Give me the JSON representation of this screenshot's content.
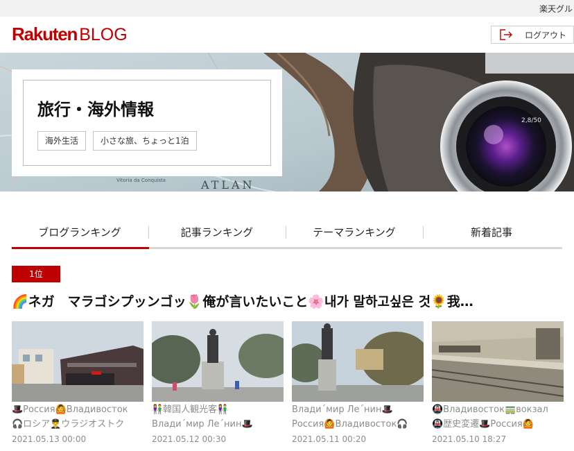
{
  "topbar": {
    "link": "楽天グル"
  },
  "header": {
    "logo_main": "Rakuten",
    "logo_sub": "BLOG",
    "logout_label": "ログアウト"
  },
  "hero": {
    "blog_title": "旅行・海外情報",
    "categories": [
      "海外生活",
      "小さな旅、ちょっと1泊"
    ],
    "map_labels": [
      "Vitoria da Conquista",
      "ATLAN"
    ],
    "lens_text": "2,8/50"
  },
  "tabs": [
    {
      "label": "ブログランキング",
      "active": true
    },
    {
      "label": "記事ランキング",
      "active": false
    },
    {
      "label": "テーマランキング",
      "active": false
    },
    {
      "label": "新着記事",
      "active": false
    }
  ],
  "ranking": {
    "badge": "1位",
    "article_title": "🌈ネガ　マラゴシプッンゴッ🌷俺が言いたいこと🌸내가 말하고싶은 것🌻我…"
  },
  "cards": [
    {
      "line1": "🎩Россия🙆Владивосток",
      "line2": "🎧ロシア👨‍✈️ウラジオストク",
      "date": "2021.05.13 00:00"
    },
    {
      "line1": "👫韓国人観光客👫",
      "line2": "Владиˊмир Леˊнин🎩",
      "date": "2021.05.12 00:30"
    },
    {
      "line1": "Владиˊмир Леˊнин🎩",
      "line2": "Россия🙆Владивосток🎧",
      "date": "2021.05.11 00:20"
    },
    {
      "line1": "🚇Владивосток🚃вокзал",
      "line2": "🚇歴史変遷🎩Россия🙆",
      "date": "2021.05.10 18:27"
    }
  ],
  "colors": {
    "brand": "#bf0000",
    "tab_line": "#d8d8d8",
    "muted_text": "#8c8c8c"
  },
  "icons": {
    "logout": "logout-icon"
  }
}
